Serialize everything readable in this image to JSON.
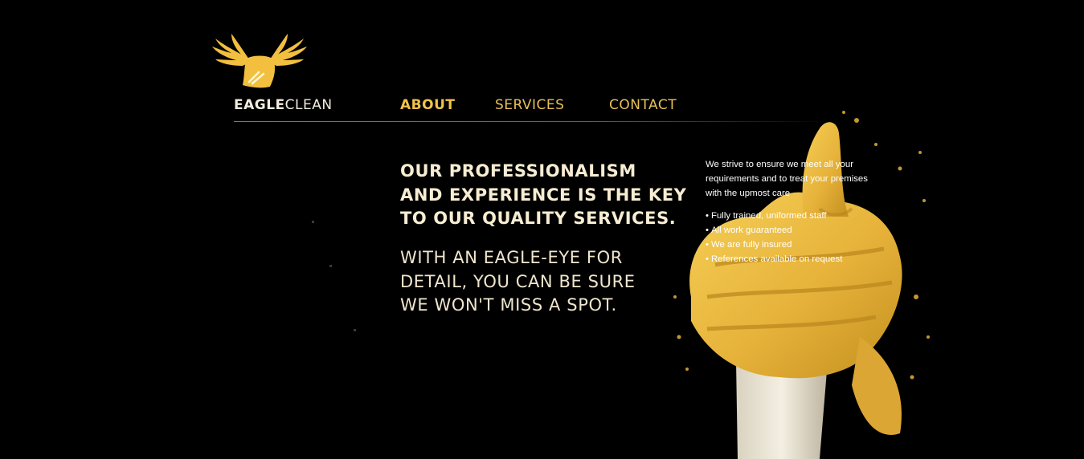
{
  "brand": {
    "name_bold": "EAGLE",
    "name_light": "CLEAN",
    "logo_icon": "eagle-logo-icon",
    "logo_color": "#f2bf3f"
  },
  "nav": {
    "items": [
      {
        "label": "ABOUT",
        "active": true
      },
      {
        "label": "SERVICES",
        "active": false
      },
      {
        "label": "CONTACT",
        "active": false
      }
    ]
  },
  "main": {
    "headline": [
      "OUR PROFESSIONALISM",
      "AND EXPERIENCE IS THE KEY",
      "TO OUR QUALITY SERVICES."
    ],
    "subline": [
      "WITH AN EAGLE-EYE FOR",
      "DETAIL, YOU CAN BE SURE",
      "WE WON'T MISS A SPOT."
    ]
  },
  "info": {
    "intro": "We strive to ensure we meet all your requirements and to treat your premises with the upmost care",
    "bullets": [
      "Fully trained, uniformed staff",
      "All work guaranteed",
      "We are fully insured",
      "References available on request"
    ]
  },
  "colors": {
    "background": "#000000",
    "accent": "#e7c05a",
    "glove": "#e9b83a",
    "text": "#f7edd2"
  },
  "hero_image": "gloved-hand-thumbs-up"
}
